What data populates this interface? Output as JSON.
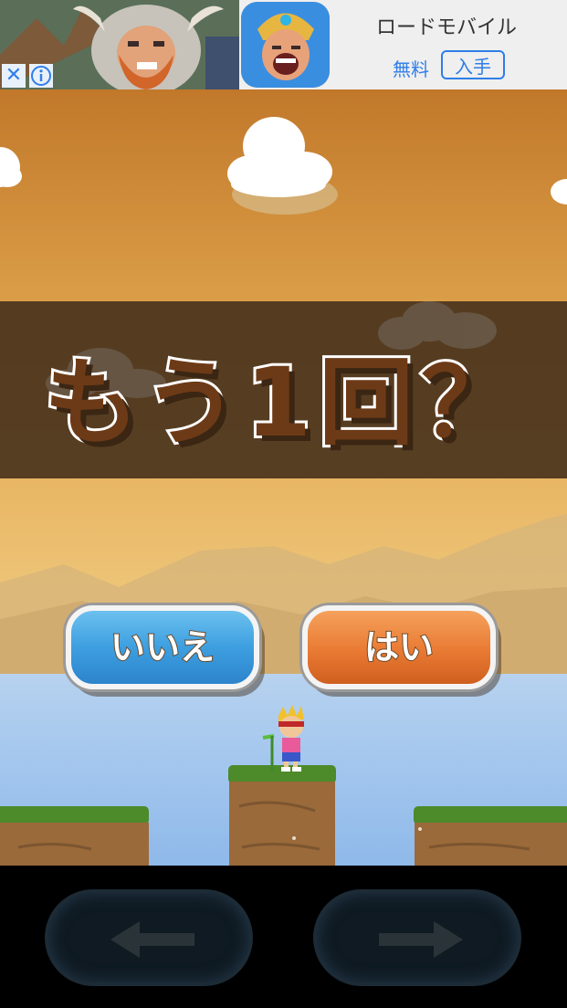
{
  "ad": {
    "title": "ロードモバイル",
    "free_label": "無料",
    "get_label": "入手",
    "close_icon": "✕",
    "info_icon": "info-icon",
    "accent_color": "#2f7ee8"
  },
  "game": {
    "prompt_text": "もう1回？",
    "no_button_label": "いいえ",
    "yes_button_label": "はい",
    "left_control_icon": "arrow-left-icon",
    "right_control_icon": "arrow-right-icon",
    "colors": {
      "sky_top": "#c1782a",
      "sky_bottom": "#f2d394",
      "banner": "#422e1a",
      "no_button": "#3d9fe0",
      "yes_button": "#e97a33",
      "water": "#a6c8ee",
      "grass": "#4d8a2a",
      "dirt": "#9a6a3a"
    }
  }
}
